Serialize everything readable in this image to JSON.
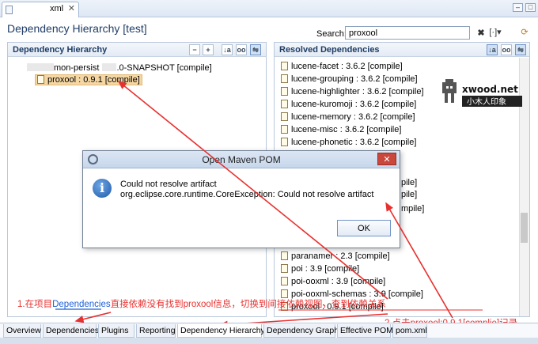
{
  "editor_tab": {
    "label": "xml",
    "close": "✕"
  },
  "window_controls": {
    "minimize": "–",
    "maximize": "□"
  },
  "title": "Dependency Hierarchy [test]",
  "search": {
    "label": "Search:",
    "value": "proxool"
  },
  "left_panel": {
    "heading": "Dependency Hierarchy",
    "root": {
      "prefix": "mon-persist",
      "suffix": ".0-SNAPSHOT [compile]"
    },
    "child": "proxool : 0.9.1 [compile]"
  },
  "right_panel": {
    "heading": "Resolved Dependencies",
    "items_top": [
      "lucene-facet : 3.6.2 [compile]",
      "lucene-grouping : 3.6.2 [compile]",
      "lucene-highlighter : 3.6.2 [compile]",
      "lucene-kuromoji : 3.6.2 [compile]",
      "lucene-memory : 3.6.2 [compile]",
      "lucene-misc : 3.6.2 [compile]",
      "lucene-phonetic : 3.6.2 [compile]"
    ],
    "partial_1": "pile]",
    "partial_2": "pile]",
    "partial_3": "mpile]",
    "items_bottom": [
      "paranamer : 2.3 [compile]",
      "poi : 3.9 [compile]",
      "poi-ooxml : 3.9 [compile]",
      "poi-ooxml-schemas : 3.9 [compile]",
      "proxool : 0.9.1 [compile]"
    ]
  },
  "dialog": {
    "title": "Open Maven POM",
    "close": "✕",
    "message_line1": "Could not resolve artifact",
    "message_line2": "org.eclipse.core.runtime.CoreException: Could not resolve artifact",
    "ok": "OK"
  },
  "logo": {
    "brand": "xwood.net",
    "cn": "小木人印象"
  },
  "bottom_tabs": [
    "Overview",
    "Dependencies",
    "Plugins",
    "Reporting",
    "Dependency Hierarchy",
    "Dependency Graph",
    "Effective POM",
    "pom.xml"
  ],
  "annotations": {
    "a1_pre": "1.在项目",
    "a1_hl": "Dependencies",
    "a1_post": "直接依赖没有找到proxool信息，切换到间接依赖视图，查到依赖关系",
    "a2": "2.点击proxool:0.9.1[complie]记录"
  },
  "colors": {
    "accent": "#1f3c66",
    "selection": "#f5d7a4",
    "annotation": "#e8312f",
    "dialog_close": "#c9473b"
  }
}
